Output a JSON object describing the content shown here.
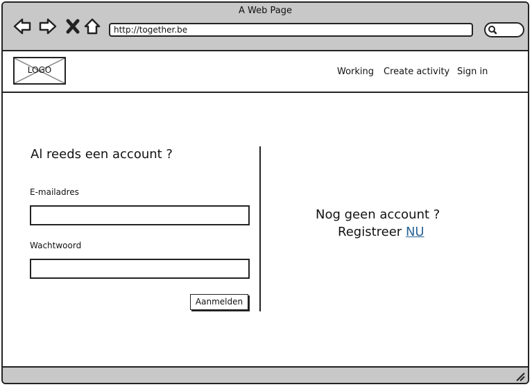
{
  "browser": {
    "title": "A Web Page",
    "url": "http://together.be"
  },
  "header": {
    "logo": "LOGO",
    "nav": [
      "Working",
      "Create activity",
      "Sign in"
    ]
  },
  "login": {
    "heading": "Al reeds een account ?",
    "email_label": "E-mailadres",
    "email_value": "",
    "password_label": "Wachtwoord",
    "password_value": "",
    "submit_label": "Aanmelden"
  },
  "register": {
    "line1": "Nog geen account ?",
    "line2": "Registreer",
    "link": "NU"
  },
  "icons": [
    "back-arrow-icon",
    "forward-arrow-icon",
    "close-icon",
    "home-icon",
    "search-icon",
    "resize-grip-icon"
  ]
}
